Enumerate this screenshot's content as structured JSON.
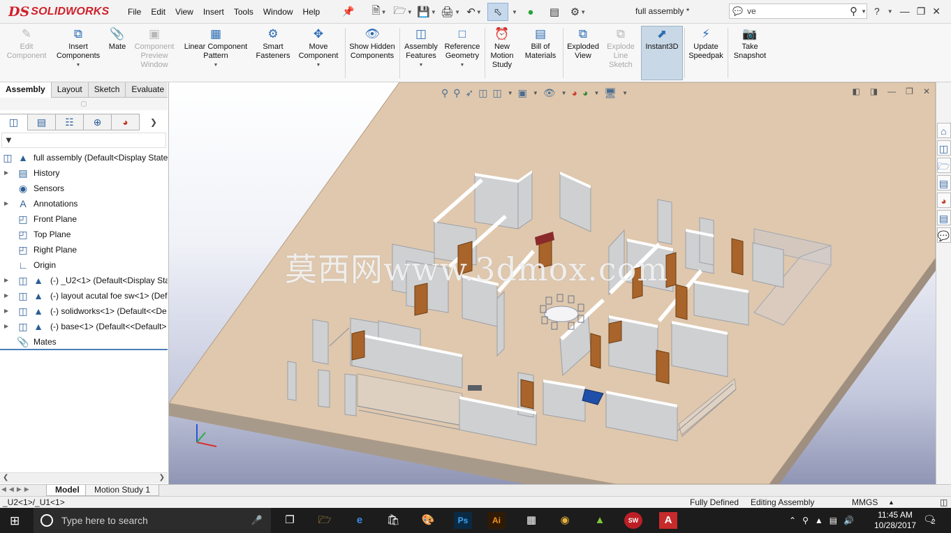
{
  "app": {
    "brand_mark": "DS",
    "brand_word": "SOLIDWORKS",
    "doc_title": "full assembly *"
  },
  "menu": [
    "File",
    "Edit",
    "View",
    "Insert",
    "Tools",
    "Window",
    "Help"
  ],
  "search": {
    "value": "ve"
  },
  "toolbar": [
    {
      "label": "Edit Component",
      "icon": "edit-component-icon",
      "enabled": false
    },
    {
      "label": "Insert Components",
      "icon": "insert-components-icon",
      "enabled": true,
      "dropdown": true
    },
    {
      "label": "Mate",
      "icon": "mate-icon",
      "enabled": true
    },
    {
      "label": "Component Preview Window",
      "icon": "component-preview-icon",
      "enabled": false
    },
    {
      "label": "Linear Component Pattern",
      "icon": "linear-pattern-icon",
      "enabled": true,
      "dropdown": true
    },
    {
      "label": "Smart Fasteners",
      "icon": "smart-fasteners-icon",
      "enabled": true
    },
    {
      "label": "Move Component",
      "icon": "move-component-icon",
      "enabled": true,
      "dropdown": true
    },
    {
      "label": "Show Hidden Components",
      "icon": "show-hidden-icon",
      "enabled": true
    },
    {
      "label": "Assembly Features",
      "icon": "assembly-features-icon",
      "enabled": true,
      "dropdown": true
    },
    {
      "label": "Reference Geometry",
      "icon": "reference-geometry-icon",
      "enabled": true,
      "dropdown": true
    },
    {
      "label": "New Motion Study",
      "icon": "motion-study-icon",
      "enabled": true
    },
    {
      "label": "Bill of Materials",
      "icon": "bom-icon",
      "enabled": true
    },
    {
      "label": "Exploded View",
      "icon": "exploded-view-icon",
      "enabled": true
    },
    {
      "label": "Explode Line Sketch",
      "icon": "explode-line-icon",
      "enabled": false
    },
    {
      "label": "Instant3D",
      "icon": "instant3d-icon",
      "enabled": true,
      "active": true
    },
    {
      "label": "Update Speedpak",
      "icon": "speedpak-icon",
      "enabled": true
    },
    {
      "label": "Take Snapshot",
      "icon": "snapshot-icon",
      "enabled": true
    }
  ],
  "tabs": [
    "Assembly",
    "Layout",
    "Sketch",
    "Evaluate"
  ],
  "tree": [
    {
      "label": "full assembly  (Default<Display State",
      "icon": "assembly-icon"
    },
    {
      "label": "History",
      "icon": "history-icon"
    },
    {
      "label": "Sensors",
      "icon": "sensors-icon"
    },
    {
      "label": "Annotations",
      "icon": "annotations-icon"
    },
    {
      "label": "Front Plane",
      "icon": "plane-icon"
    },
    {
      "label": "Top Plane",
      "icon": "plane-icon"
    },
    {
      "label": "Right Plane",
      "icon": "plane-icon"
    },
    {
      "label": "Origin",
      "icon": "origin-icon"
    },
    {
      "label": "(-) _U2<1> (Default<Display Sta",
      "icon": "subassembly-icon"
    },
    {
      "label": "(-) layout acutal foe sw<1> (Def",
      "icon": "subassembly-icon"
    },
    {
      "label": "(-) solidworks<1> (Default<<De",
      "icon": "subassembly-icon"
    },
    {
      "label": "(-) base<1> (Default<<Default>",
      "icon": "subassembly-icon"
    },
    {
      "label": "Mates",
      "icon": "mates-icon"
    }
  ],
  "watermark": "莫西网www.3dmox.com",
  "bottom_tabs": [
    "Model",
    "Motion Study 1"
  ],
  "status": {
    "left": "_U2<1>/_U1<1>",
    "defined": "Fully Defined",
    "mode": "Editing Assembly",
    "units": "MMGS"
  },
  "taskbar": {
    "search_placeholder": "Type here to search",
    "ps_label": "Ps",
    "ai_label": "Ai",
    "sw_label": "SW",
    "time": "11:45 AM",
    "date": "10/28/2017",
    "notifications": "2"
  },
  "colors": {
    "brand_red": "#d0202a",
    "floor": "#dfc8ae",
    "walls": "#cfd0d2",
    "doors": "#a8642a"
  }
}
